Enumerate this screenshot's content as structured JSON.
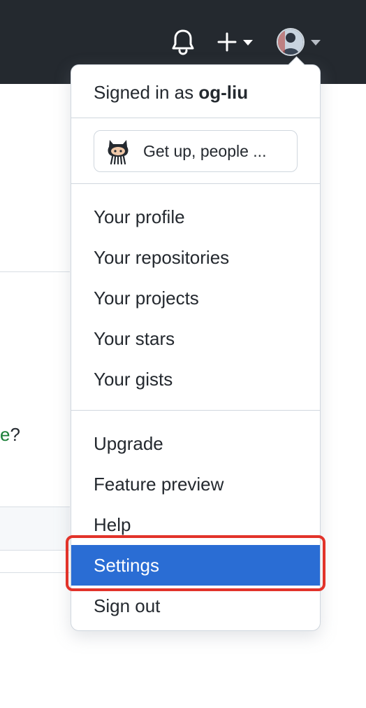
{
  "header": {
    "icons": [
      "bell-icon",
      "plus-icon",
      "chevron-down-icon",
      "avatar"
    ],
    "background_color": "#24292f"
  },
  "background": {
    "visible_text_fragment": "e",
    "question_mark": "?",
    "fragment_color": "#1a7f37"
  },
  "dropdown": {
    "signed_in_prefix": "Signed in as",
    "username": "og-liu",
    "status_text": "Get up, people ...",
    "group1": [
      {
        "label": "Your profile"
      },
      {
        "label": "Your repositories"
      },
      {
        "label": "Your projects"
      },
      {
        "label": "Your stars"
      },
      {
        "label": "Your gists"
      }
    ],
    "group2": [
      {
        "label": "Upgrade"
      },
      {
        "label": "Feature preview"
      },
      {
        "label": "Help"
      },
      {
        "label": "Settings",
        "active": true
      },
      {
        "label": "Sign out"
      }
    ],
    "active_color": "#2a6dd4",
    "highlight_color": "#e2332a"
  }
}
